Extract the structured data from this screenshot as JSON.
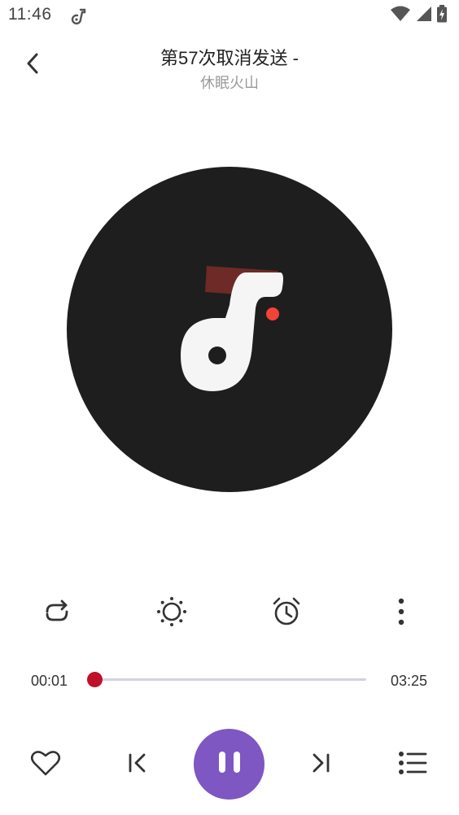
{
  "status_bar": {
    "time": "11:46",
    "icons": [
      "music-note-icon",
      "wifi-icon",
      "signal-icon",
      "battery-icon"
    ]
  },
  "header": {
    "back_icon": "chevron-left-icon",
    "title": "第57次取消发送 -",
    "artist": "休眠火山"
  },
  "album_art": {
    "disc_color": "#1e1e1e",
    "logo": "music-app-logo-icon"
  },
  "action_row": {
    "items": [
      "repeat-icon",
      "brightness-icon",
      "alarm-clock-icon",
      "more-vert-icon"
    ]
  },
  "progress": {
    "elapsed": "00:01",
    "duration": "03:25",
    "fraction": 0.005,
    "accent": "#c0102a",
    "track_color": "#d6cfe6"
  },
  "playback": {
    "items": [
      "heart-icon",
      "skip-previous-icon",
      "pause-icon",
      "skip-next-icon",
      "playlist-icon"
    ],
    "play_button_color": "#7e57c2"
  }
}
